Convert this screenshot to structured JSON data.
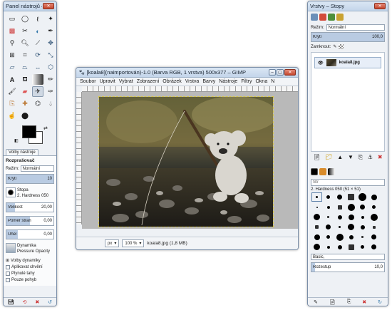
{
  "toolbox": {
    "title": "Panel nástrojů – Vo...",
    "tab_label": "Volby nástroje",
    "tool_name": "Rozprašovač",
    "mode_label": "Režim:",
    "mode_value": "Normální",
    "opacity_label": "Krytí",
    "opacity_value": "10",
    "brush_label": "Stopa",
    "brush_value": "2. Hardness 050",
    "size_label": "Velikost",
    "size_value": "20,00",
    "ratio_label": "Poměr stran",
    "ratio_value": "0,00",
    "angle_label": "Úhel",
    "angle_value": "0,00",
    "dynamics_label": "Dynamika",
    "dynamics_value": "Pressure Opacity",
    "dynamics_options": "Volby dynamiky",
    "apply_jitter": "Aplikovat chvění",
    "smooth_stroke": "Plynulé tahy",
    "motion_only": "Pouze pohyb"
  },
  "image_window": {
    "title": "[koala8](naimportován)-1.0 (Barva RGB, 1 vrstva) 500x377 – GIMP",
    "menu": [
      "Soubor",
      "Upravit",
      "Vybrat",
      "Zobrazení",
      "Obrázek",
      "Vrstva",
      "Barvy",
      "Nástroje",
      "Filtry",
      "Okna",
      "N"
    ],
    "unit": "px",
    "zoom": "100 %",
    "status": "koala8.jpg (1,8 MB)"
  },
  "layers_dock": {
    "title": "Vrstvy – Stopy",
    "mode_label": "Režim:",
    "mode_value": "Normální",
    "opacity_label": "Krytí",
    "opacity_value": "100,0",
    "lock_label": "Zamknout:",
    "layer_name": "koala8.jpg",
    "filter_placeholder": "filtr",
    "brush_name": "2. Hardness 050 (51 × 51)",
    "preset_name": "Basic,",
    "spacing_label": "Rozestup",
    "spacing_value": "10,0"
  },
  "colors": {
    "accent": "#b9cbe2",
    "foreground": "#000000",
    "background": "#ffffff"
  }
}
